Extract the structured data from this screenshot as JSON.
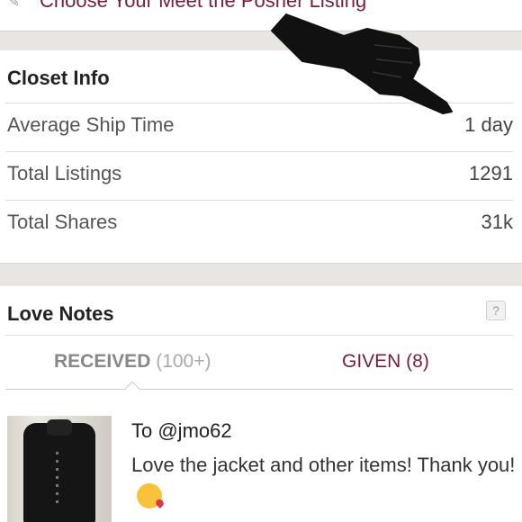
{
  "top_link": {
    "text": "Choose Your Meet the Posher Listing"
  },
  "closet_info": {
    "title": "Closet Info",
    "rows": [
      {
        "label": "Average Ship Time",
        "value": "1 day"
      },
      {
        "label": "Total Listings",
        "value": "1291"
      },
      {
        "label": "Total Shares",
        "value": "31k"
      }
    ]
  },
  "love_notes": {
    "title": "Love Notes",
    "help_icon": "?",
    "tabs": {
      "received_label": "RECEIVED",
      "received_count": "(100+)",
      "given_label": "GIVEN (8)"
    },
    "note": {
      "to": "To @jmo62",
      "body": "Love the jacket and other items! Thank you!",
      "emoji": "kissing-face-icon"
    }
  },
  "colors": {
    "accent": "#7a1c3c",
    "divider": "#dddddd",
    "background": "#ebe8e3"
  }
}
